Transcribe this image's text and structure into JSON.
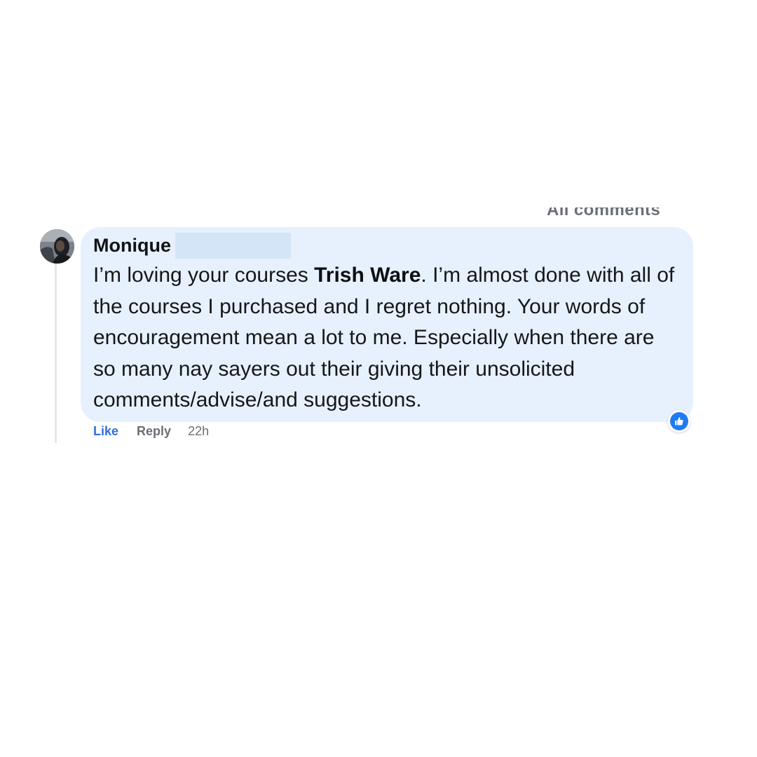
{
  "header": {
    "section_label": "All comments"
  },
  "comment": {
    "author": "Monique",
    "text_before_mention": "I’m loving your courses ",
    "mention": "Trish Ware",
    "text_after_mention": ". I’m almost done with all of the courses I purchased and I regret nothing. Your words of encouragement mean a lot to me. Especially when there are so many nay sayers out their giving their unsolicited comments/advise/and suggestions.",
    "actions": {
      "like_label": "Like",
      "reply_label": "Reply",
      "timestamp": "22h"
    },
    "reaction_icon": "like-reaction-icon"
  },
  "colors": {
    "bubble_background": "#e7f1fd",
    "link_blue": "#2f6fe0",
    "secondary_text": "#6b6f75",
    "reaction_blue": "#1f7bf2"
  }
}
